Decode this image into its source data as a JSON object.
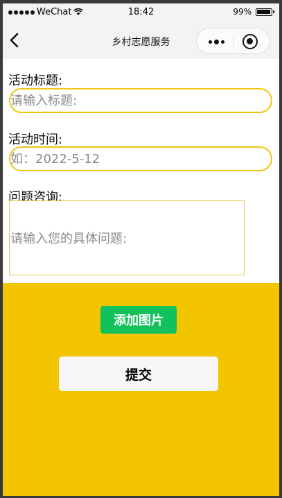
{
  "status_bar": {
    "carrier": "WeChat",
    "time": "18:42",
    "battery_percent": "99%",
    "battery_level": 0.99
  },
  "navbar": {
    "title": "乡村志愿服务",
    "back_icon": "chevron-left-icon",
    "more_icon": "more-dots-icon",
    "close_icon": "record-close-icon"
  },
  "form": {
    "activity_title": {
      "label": "活动标题:",
      "placeholder": "请输入标题:"
    },
    "activity_time": {
      "label": "活动时间:",
      "placeholder": "如：2022-5-12"
    },
    "question": {
      "label": "问题咨询:",
      "placeholder": "请输入您的具体问题:"
    }
  },
  "actions": {
    "add_image_label": "添加图片",
    "submit_label": "提交"
  },
  "colors": {
    "accent_yellow": "#f2c500",
    "input_border": "#f1c40f",
    "add_image_green": "#13c15c"
  }
}
